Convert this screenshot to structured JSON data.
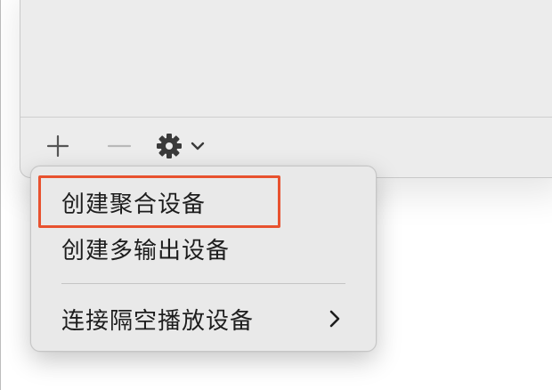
{
  "toolbar": {
    "add_icon": "plus-icon",
    "remove_icon": "minus-icon",
    "settings_icon": "gear-icon",
    "dropdown_icon": "chevron-down-icon"
  },
  "menu": {
    "items": [
      {
        "label": "创建聚合设备",
        "highlighted": true
      },
      {
        "label": "创建多输出设备",
        "highlighted": false
      },
      {
        "label": "连接隔空播放设备",
        "has_submenu": true
      }
    ],
    "submenu_icon": "chevron-right-icon"
  },
  "colors": {
    "highlight_border": "#e8522f",
    "menu_bg": "#e9e9e9",
    "panel_bg": "#ececec"
  }
}
